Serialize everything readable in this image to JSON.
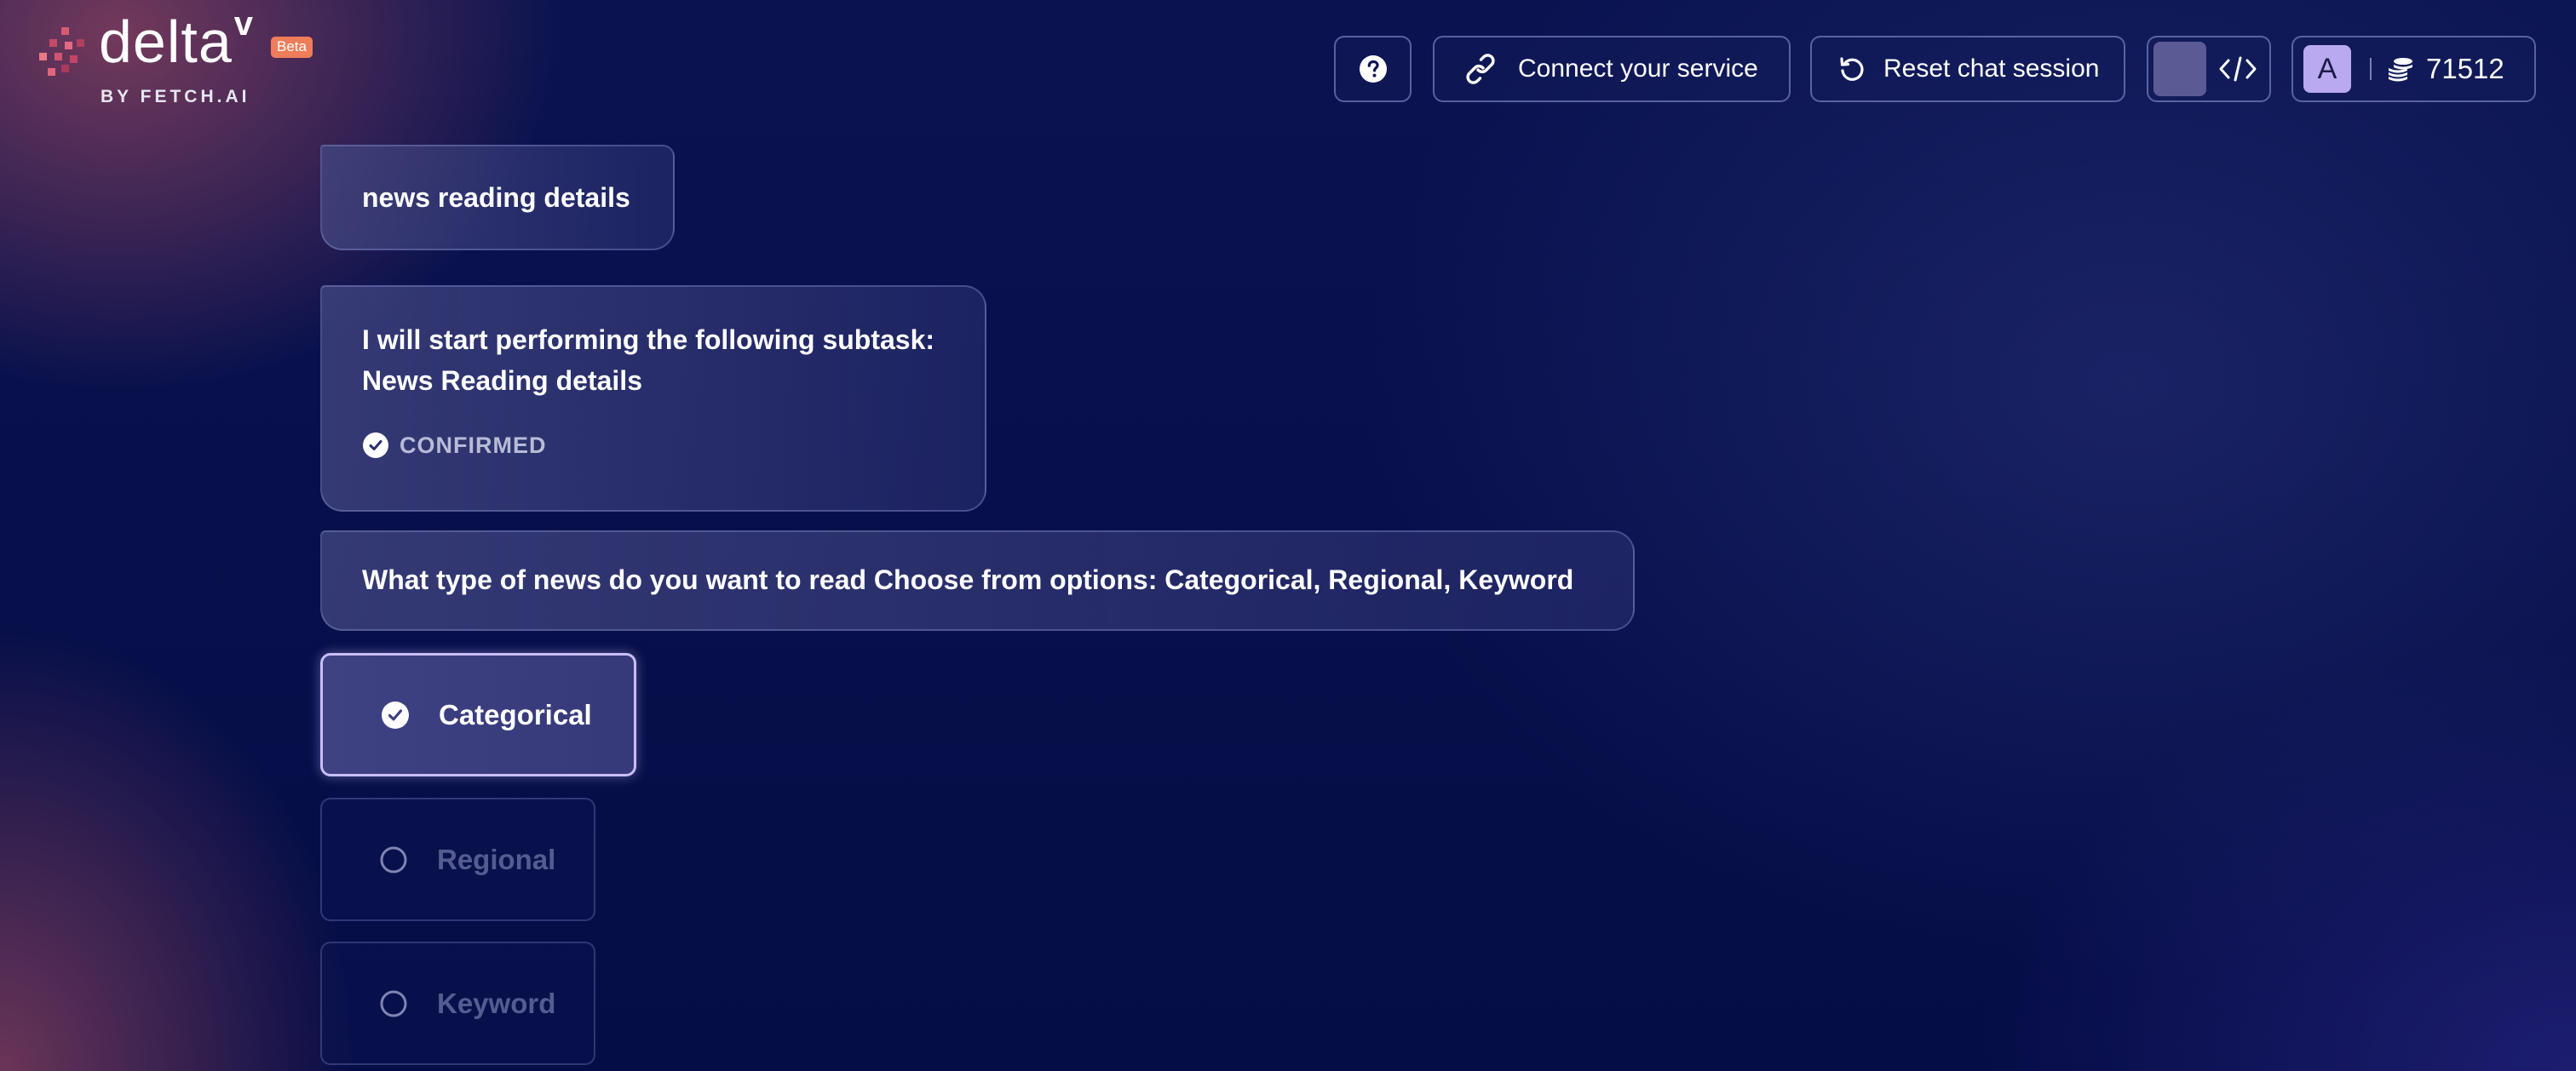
{
  "brand": {
    "name": "delta",
    "superscript": "v",
    "badge": "Beta",
    "byline": "BY FETCH.AI",
    "accent": "#ef7d59"
  },
  "header": {
    "help_icon": "question-circle-icon",
    "connect_label": "Connect your service",
    "connect_icon": "link-icon",
    "reset_label": "Reset chat session",
    "reset_icon": "undo-icon",
    "dev_icon": "code-icon",
    "avatar_letter": "A",
    "coins_icon": "coins-icon",
    "balance": "71512"
  },
  "chat": {
    "user_message": "news reading details",
    "subtask_line1": "I will start performing the following subtask:",
    "subtask_line2": "News Reading details",
    "subtask_status": "CONFIRMED",
    "question": "What type of news do you want to read Choose from options: Categorical, Regional, Keyword",
    "options": [
      {
        "label": "Categorical",
        "selected": true
      },
      {
        "label": "Regional",
        "selected": false
      },
      {
        "label": "Keyword",
        "selected": false
      }
    ]
  }
}
